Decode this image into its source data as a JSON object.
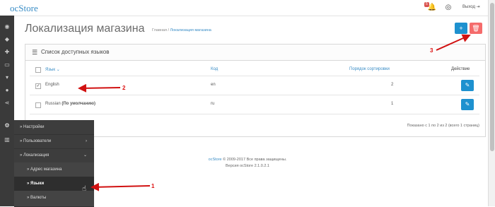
{
  "header": {
    "logo": "ocStore",
    "notification_count": "5",
    "logout_label": "Выход"
  },
  "page": {
    "title": "Локализация магазина",
    "breadcrumbs": [
      "Главная",
      "Локализация магазина"
    ],
    "add_button_icon": "plus-icon",
    "delete_button_icon": "trash-icon"
  },
  "panel": {
    "title": "Список доступных языков",
    "columns": {
      "name": "Язык",
      "code": "Код",
      "sort": "Порядок сортировки",
      "action": "Действие"
    },
    "rows": [
      {
        "name": "English",
        "default_suffix": "",
        "code": "en",
        "sort": "2",
        "checked": true
      },
      {
        "name": "Russian",
        "default_suffix": "(По умолчанию)",
        "code": "ru",
        "sort": "1",
        "checked": false
      }
    ],
    "pagination": "Показано с 1 по 2 из 2 (всего 1 страниц)"
  },
  "sidebar_menu": [
    {
      "label": "Настройки",
      "expand": ""
    },
    {
      "label": "Пользователи",
      "expand": "›"
    },
    {
      "label": "Локализация",
      "expand": "⌄"
    },
    {
      "label": "Адрес магазина",
      "expand": ""
    },
    {
      "label": "Языки",
      "expand": ""
    },
    {
      "label": "Валюты",
      "expand": ""
    }
  ],
  "footer": {
    "line1_link": "ocStore",
    "line1_rest": "© 2009-2017 Все права защищены.",
    "line2": "Версия ocStore 2.1.0.2.1"
  },
  "annotations": [
    "1",
    "2",
    "3"
  ],
  "colors": {
    "primary": "#1e91cf",
    "danger": "#f56b6b",
    "sidebar": "#3a3a3a",
    "marker": "#d11111"
  }
}
